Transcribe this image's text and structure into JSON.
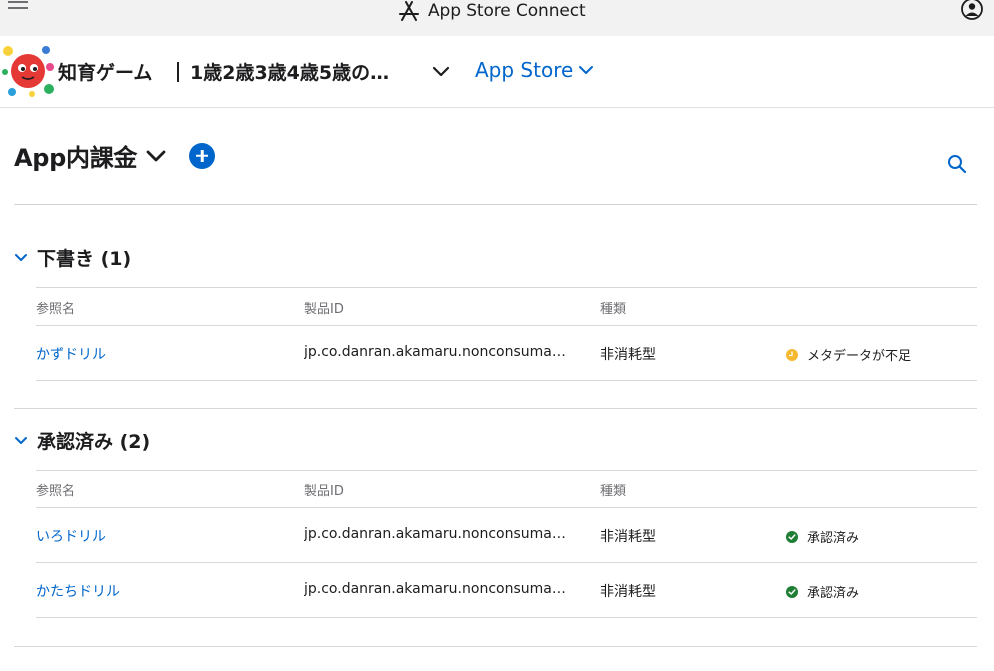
{
  "topbar": {
    "title": "App Store Connect"
  },
  "app": {
    "name": "知育ゲーム",
    "subtitle": "1歳2歳3歳4歳5歳の…",
    "platform": "App Store"
  },
  "page": {
    "title": "App内課金"
  },
  "columns": {
    "reference_name": "参照名",
    "product_id": "製品ID",
    "type": "種類"
  },
  "sections": {
    "draft": {
      "title": "下書き (1)",
      "rows": [
        {
          "name": "かずドリル",
          "product_id": "jp.co.danran.akamaru.nonconsumable",
          "type": "非消耗型",
          "status": "メタデータが不足"
        }
      ]
    },
    "approved": {
      "title": "承認済み (2)",
      "rows": [
        {
          "name": "いろドリル",
          "product_id": "jp.co.danran.akamaru.nonconsumable",
          "type": "非消耗型",
          "status": "承認済み"
        },
        {
          "name": "かたちドリル",
          "product_id": "jp.co.danran.akamaru.nonconsumable",
          "type": "非消耗型",
          "status": "承認済み"
        }
      ]
    }
  },
  "colors": {
    "accent": "#0066cc",
    "warning": "#f5b82e",
    "success": "#1e7e34"
  }
}
